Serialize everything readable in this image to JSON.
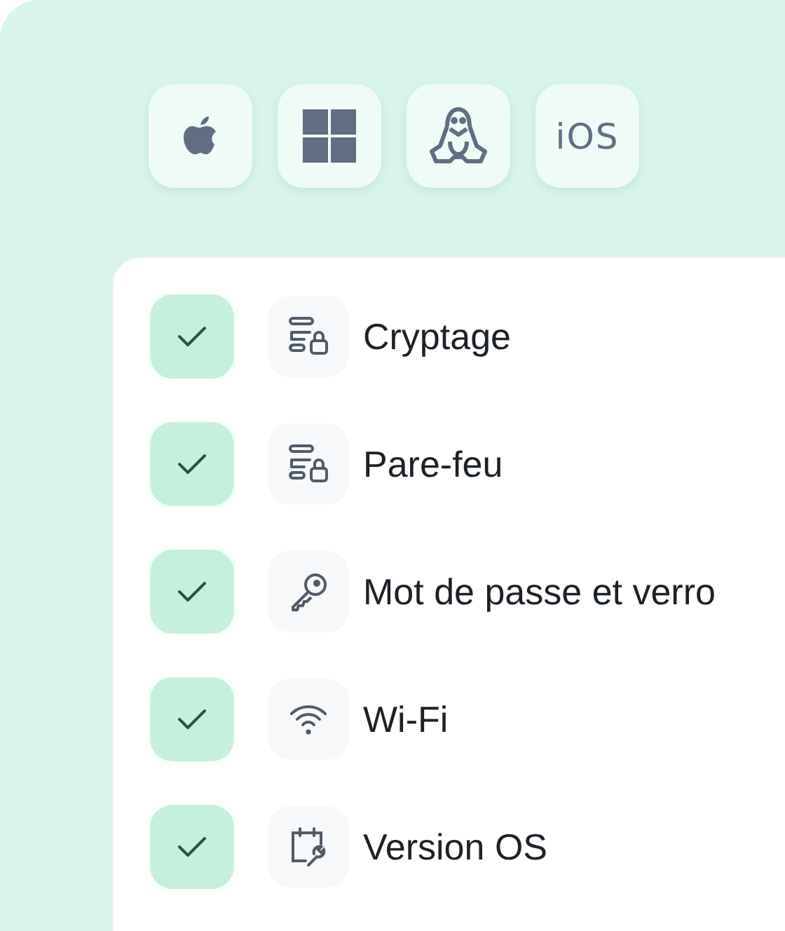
{
  "platforms": [
    {
      "kind": "apple"
    },
    {
      "kind": "windows"
    },
    {
      "kind": "linux"
    },
    {
      "kind": "ios",
      "label": "iOS"
    }
  ],
  "checks": [
    {
      "label": "Cryptage",
      "kind": "lock",
      "checked": true
    },
    {
      "label": "Pare-feu",
      "kind": "lock",
      "checked": true
    },
    {
      "label": "Mot de passe et verro",
      "kind": "key",
      "checked": true
    },
    {
      "label": "Wi-Fi",
      "kind": "wifi",
      "checked": true
    },
    {
      "label": "Version OS",
      "kind": "calendar",
      "checked": true
    }
  ]
}
